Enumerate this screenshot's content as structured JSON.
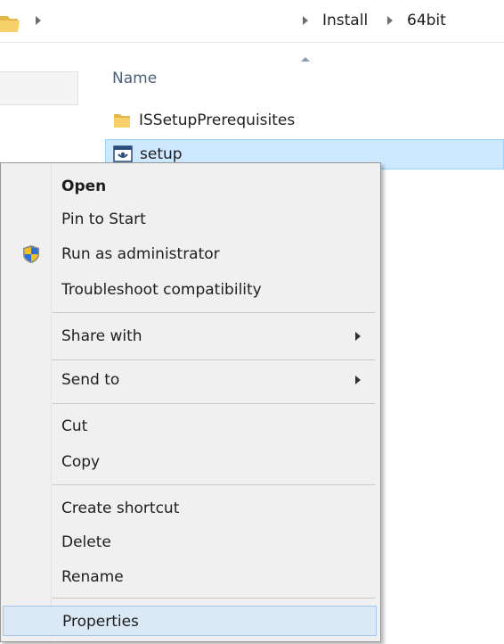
{
  "address_bar": {
    "folder_icon": "folder-icon",
    "breadcrumbs": [
      "Install",
      "64bit"
    ]
  },
  "file_list": {
    "column_name": "Name",
    "sort_indicator": "sort-ascending-icon",
    "items": [
      {
        "name": "ISSetupPrerequisites",
        "icon": "folder-icon",
        "selected": false
      },
      {
        "name": "setup",
        "icon": "setup-exe-icon",
        "selected": true
      }
    ]
  },
  "context_menu": {
    "items": [
      {
        "label": "Open",
        "bold": true
      },
      {
        "label": "Pin to Start"
      },
      {
        "label": "Run as administrator",
        "icon": "uac-shield-icon"
      },
      {
        "label": "Troubleshoot compatibility"
      },
      {
        "label": "Share with",
        "submenu": true
      },
      {
        "label": "Send to",
        "submenu": true
      },
      {
        "label": "Cut"
      },
      {
        "label": "Copy"
      },
      {
        "label": "Create shortcut"
      },
      {
        "label": "Delete"
      },
      {
        "label": "Rename"
      },
      {
        "label": "Properties",
        "highlighted": true
      }
    ]
  },
  "colors": {
    "selection_bg": "#cde8ff",
    "selection_border": "#99d1ff",
    "menu_bg": "#f0f0f0",
    "menu_highlight": "#dbe8f6",
    "header_text": "#4c607a"
  }
}
